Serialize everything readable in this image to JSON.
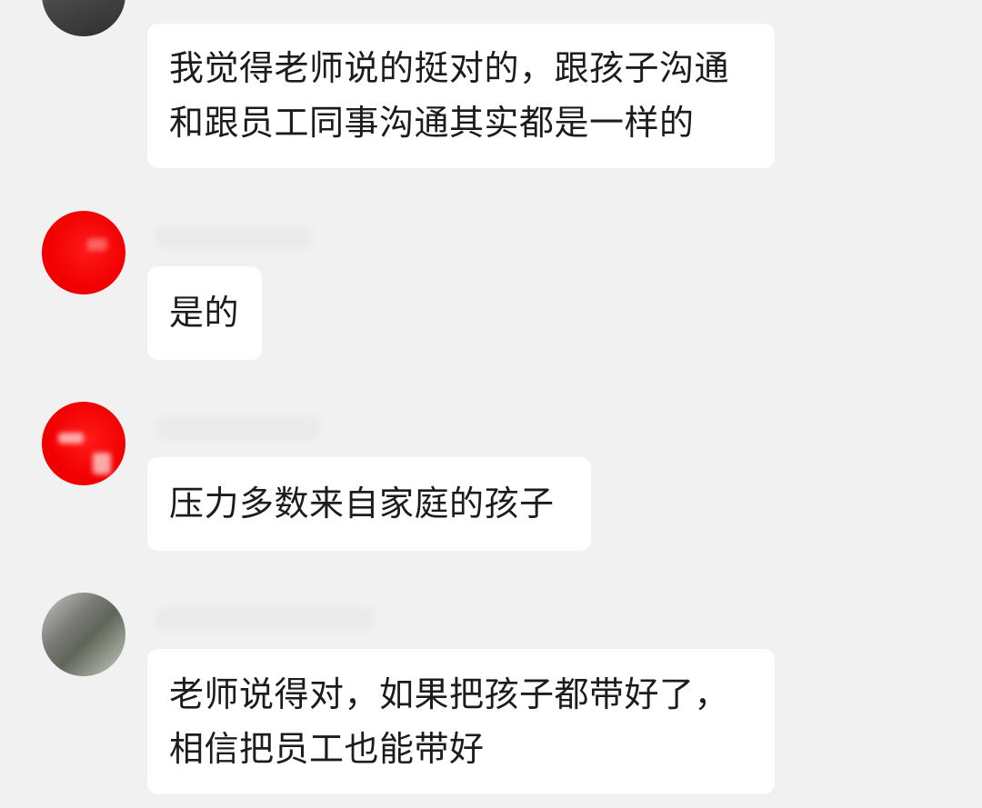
{
  "chat": {
    "messages": [
      {
        "avatar": "user-avatar-dark",
        "lines": [
          "我觉得老师说的挺对的，跟孩子沟通",
          "和跟员工同事沟通其实都是一样的"
        ]
      },
      {
        "avatar": "user-avatar-red",
        "lines": [
          "是的"
        ]
      },
      {
        "avatar": "user-avatar-red",
        "lines": [
          "压力多数来自家庭的孩子"
        ]
      },
      {
        "avatar": "user-avatar-photo",
        "lines": [
          "老师说得对，如果把孩子都带好了，",
          "相信把员工也能带好"
        ]
      }
    ]
  },
  "colors": {
    "background": "#f1f1f1",
    "bubble": "#ffffff",
    "avatar_red": "#f20000",
    "text": "#1c1c1c"
  }
}
